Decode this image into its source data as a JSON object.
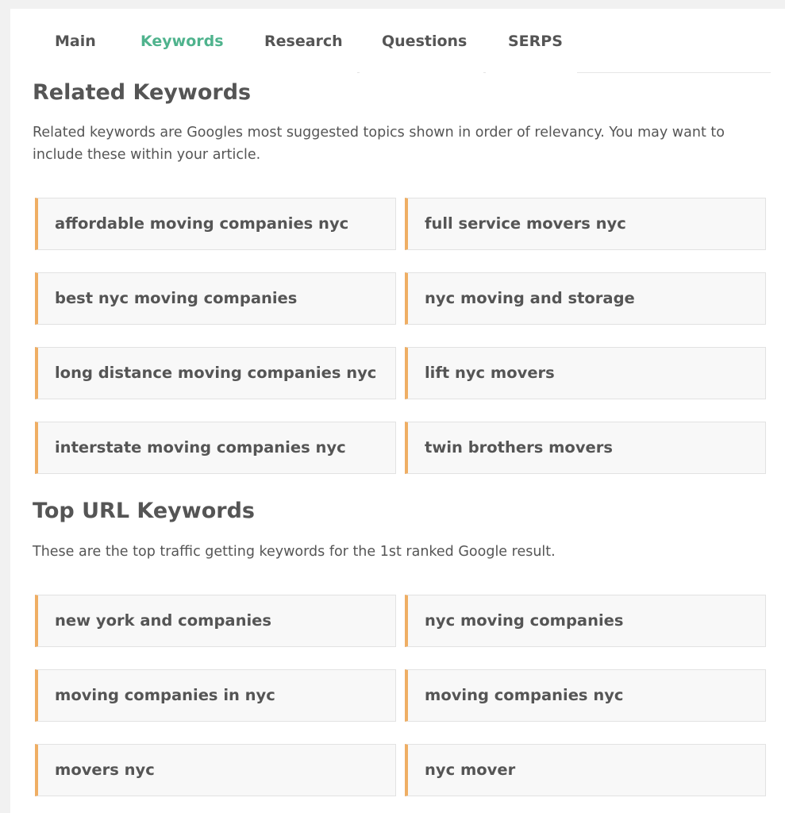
{
  "tabs": [
    {
      "label": "Main"
    },
    {
      "label": "Keywords"
    },
    {
      "label": "Research"
    },
    {
      "label": "Questions"
    },
    {
      "label": "SERPS"
    }
  ],
  "active_tab": "Keywords",
  "accent_color": "#4fb38d",
  "keyword_border_color": "#efae64",
  "related": {
    "title": "Related Keywords",
    "description": "Related keywords are Googles most suggested topics shown in order of relevancy. You may want to include these within your article.",
    "keywords": [
      "affordable moving companies nyc",
      "full service movers nyc",
      "best nyc moving companies",
      "nyc moving and storage",
      "long distance moving companies nyc",
      "lift nyc movers",
      "interstate moving companies nyc",
      "twin brothers movers"
    ]
  },
  "top_url": {
    "title": "Top URL Keywords",
    "description": "These are the top traffic getting keywords for the 1st ranked Google result.",
    "keywords": [
      "new york and companies",
      "nyc moving companies",
      "moving companies in nyc",
      "moving companies nyc",
      "movers nyc",
      "nyc mover"
    ]
  }
}
